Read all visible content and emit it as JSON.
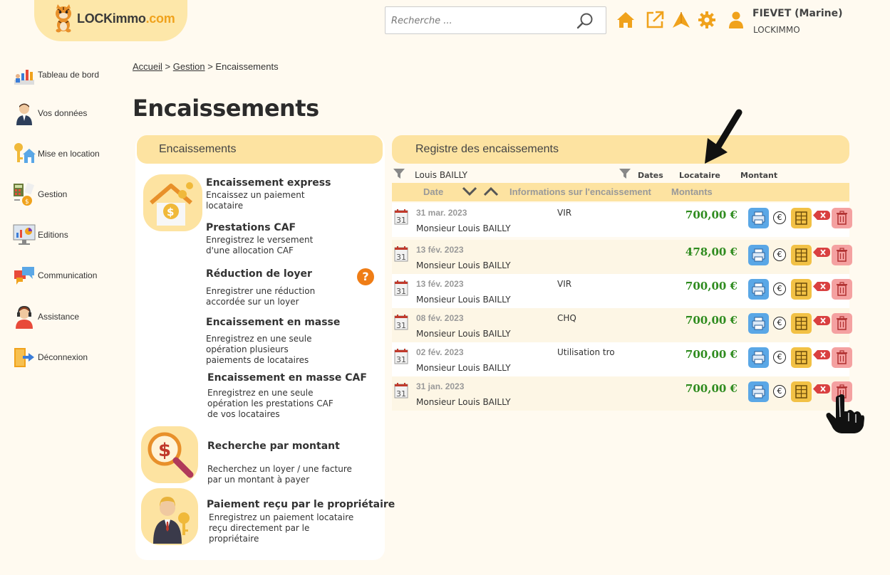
{
  "header": {
    "logo_text": "LOCKimmo",
    "logo_suffix": ".com",
    "search_placeholder": "Recherche ...",
    "user_name": "FIEVET (Marine)",
    "user_org": "LOCKIMMO"
  },
  "sidebar": {
    "items": [
      {
        "label": "Tableau de bord",
        "icon": "dashboard-chart-icon"
      },
      {
        "label": "Vos données",
        "icon": "user-person-icon"
      },
      {
        "label": "Mise en location",
        "icon": "key-house-icon"
      },
      {
        "label": "Gestion",
        "icon": "calculator-icon"
      },
      {
        "label": "Editions",
        "icon": "monitor-chart-icon"
      },
      {
        "label": "Communication",
        "icon": "chat-bubbles-icon"
      },
      {
        "label": "Assistance",
        "icon": "headset-agent-icon"
      },
      {
        "label": "Déconnexion",
        "icon": "logout-door-icon"
      }
    ]
  },
  "breadcrumb": {
    "home": "Accueil",
    "sep1": ">",
    "section": "Gestion",
    "sep2": ">",
    "current": "Encaissements"
  },
  "page_title": "Encaissements",
  "left_panel": {
    "title": "Encaissements",
    "actions": [
      {
        "title": "Encaissement express",
        "desc": "Encaissez un paiement\nlocataire"
      },
      {
        "title": "Prestations CAF",
        "desc": "Enregistrez le versement\nd'une allocation CAF"
      },
      {
        "title": "Réduction de loyer",
        "desc": "Enregistrer une réduction\naccordée sur un loyer"
      },
      {
        "title": "Encaissement en masse",
        "desc": "Enregistrez en une seule\nopération plusieurs\npaiements de locataires"
      },
      {
        "title": "Encaissement en masse CAF",
        "desc": "Enregistrez en une seule\nopération les prestations CAF\nde vos locataires"
      },
      {
        "title": "Recherche par montant",
        "desc": "Recherchez un loyer / une facture\npar un montant à payer"
      },
      {
        "title": "Paiement reçu par le propriétaire",
        "desc": "Enregistrez un paiement locataire\nreçu directement par le\npropriétaire"
      }
    ],
    "help": "?"
  },
  "right_panel": {
    "title": "Registre des encaissements",
    "filter_value": "Louis BAILLY",
    "filter_dates": "Dates",
    "filter_tenant": "Locataire",
    "filter_amount": "Montant",
    "col_date": "Date",
    "col_info": "Informations sur l'encaissement",
    "col_amounts": "Montants",
    "calendar_day": "31",
    "euro_symbol": "€",
    "rows": [
      {
        "date": "31 mar. 2023",
        "tenant": "Monsieur Louis BAILLY",
        "info": "VIR",
        "amount": "700,00 €"
      },
      {
        "date": "13 fév. 2023",
        "tenant": "Monsieur Louis BAILLY",
        "info": "",
        "amount": "478,00 €"
      },
      {
        "date": "13 fév. 2023",
        "tenant": "Monsieur Louis BAILLY",
        "info": "VIR",
        "amount": "700,00 €"
      },
      {
        "date": "08 fév. 2023",
        "tenant": "Monsieur Louis BAILLY",
        "info": "CHQ",
        "amount": "700,00 €"
      },
      {
        "date": "02 fév. 2023",
        "tenant": "Monsieur Louis BAILLY",
        "info": "Utilisation tro",
        "amount": "700,00 €"
      },
      {
        "date": "31 jan. 2023",
        "tenant": "Monsieur Louis BAILLY",
        "info": "",
        "amount": "700,00 €"
      }
    ]
  },
  "colors": {
    "accent": "#fde3a1",
    "amount_green": "#2e8b1e",
    "print_blue": "#5aa7e6",
    "receipt_yellow": "#f2c145",
    "delete_pink": "#f4a1a1",
    "help_orange": "#ef7d16"
  }
}
